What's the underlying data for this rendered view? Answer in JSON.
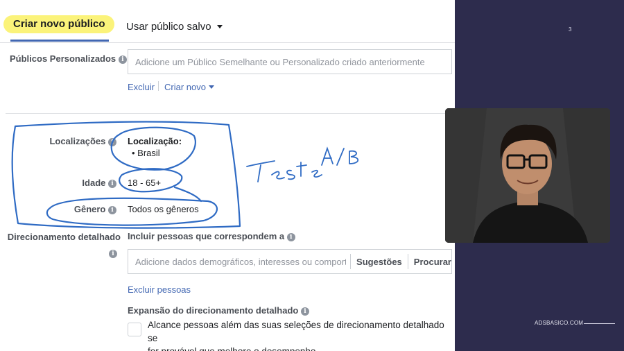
{
  "tabs": {
    "create_new": "Criar novo público",
    "use_saved": "Usar público salvo"
  },
  "custom_audiences": {
    "label": "Públicos Personalizados",
    "placeholder": "Adicione um Público Semelhante ou Personalizado criado anteriormente",
    "exclude_link": "Excluir",
    "create_new_link": "Criar novo"
  },
  "locations": {
    "label": "Localizações",
    "heading": "Localização:",
    "items": [
      "Brasil"
    ]
  },
  "age": {
    "label": "Idade",
    "value": "18 - 65+"
  },
  "gender": {
    "label": "Gênero",
    "value": "Todos os gêneros"
  },
  "detailed_targeting": {
    "label": "Direcionamento detalhado",
    "include_text": "Incluir pessoas que correspondem a",
    "placeholder": "Adicione dados demográficos, interesses ou comportamentos",
    "suggestions_button": "Sugestões",
    "browse_button": "Procurar",
    "exclude_link": "Excluir pessoas",
    "expansion_title": "Expansão do direcionamento detalhado",
    "expansion_text_line1": "Alcance pessoas além das suas seleções de direcionamento detalhado se",
    "expansion_text_line2": "for provável que melhore o desempenho."
  },
  "annotation": {
    "handwritten": "Teste A/B",
    "ink_color": "#2f6bc4"
  },
  "presenter_panel": {
    "page_number": "3",
    "brand": "ADSBASICO.COM",
    "background": "#2d2c4d"
  },
  "colors": {
    "link_blue": "#4267b2",
    "highlight_yellow": "#fbf37a"
  }
}
